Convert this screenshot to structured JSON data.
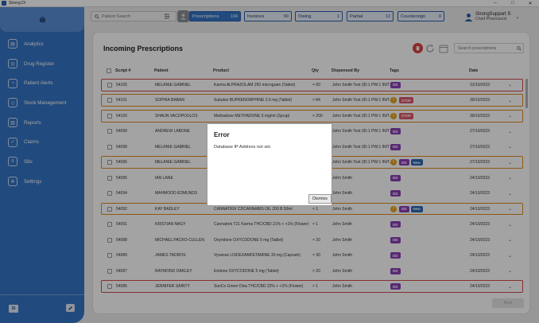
{
  "window": {
    "title": "Strong DI",
    "controls": [
      "–",
      "□",
      "✕"
    ]
  },
  "sidebar": {
    "items": [
      {
        "label": "Analytics",
        "icon": "analytics-icon",
        "glyph": "▤"
      },
      {
        "label": "Drug Register",
        "icon": "drug-register-icon",
        "glyph": "◎"
      },
      {
        "label": "Patient Alerts",
        "icon": "bell-icon",
        "glyph": "◔"
      },
      {
        "label": "Stock Management",
        "icon": "box-icon",
        "glyph": "◇"
      },
      {
        "label": "Reports",
        "icon": "bar-chart-icon",
        "glyph": "▥"
      },
      {
        "label": "Claims",
        "icon": "check-circle-icon",
        "glyph": "✓"
      },
      {
        "label": "S8s",
        "icon": "document-icon",
        "glyph": "≡"
      },
      {
        "label": "Settings",
        "icon": "gear-icon",
        "glyph": "✲"
      }
    ],
    "user_initials": "SI"
  },
  "topbar": {
    "search_placeholder": "Patient Search",
    "tabs": [
      {
        "label": "Prescriptions",
        "count": "104",
        "active": true
      },
      {
        "label": "Invoices",
        "count": "60",
        "active": false
      },
      {
        "label": "Owing",
        "count": "1",
        "active": false
      },
      {
        "label": "Partial",
        "count": "12",
        "active": false
      },
      {
        "label": "Countersign",
        "count": "0",
        "active": false
      }
    ],
    "user": {
      "name": "StrongSupport S",
      "role": "Chief Pharmacist"
    }
  },
  "main": {
    "title": "Incoming Prescriptions",
    "search_placeholder": "Search prescriptions",
    "columns": [
      "Script #",
      "Patient",
      "Product",
      "Qty",
      "Dispensed By",
      "Tags",
      "Date"
    ],
    "rows": [
      {
        "script": "54105",
        "patient": "MELANIE GABRIEL",
        "product": "Karma ALPRAZOLAM 250 microgram (Tablet)",
        "qty": "× 60",
        "dispensed_by": "John Smith Test (ID:1 PW:1 INIT...",
        "tags": [
          "DD"
        ],
        "warning": false,
        "date": "31/10/2023",
        "highlight": "red"
      },
      {
        "script": "54101",
        "patient": "SOPHIA BABAN",
        "product": "Subutex BUPRENORPHINE 2.0 mg (Tablet)",
        "qty": "× 84",
        "dispensed_by": "John Smith Test (ID:1 PW:1 INIT...",
        "tags": [
          "STOP"
        ],
        "warning": true,
        "date": "30/10/2023",
        "highlight": "orange"
      },
      {
        "script": "54100",
        "patient": "SHAUN VACOPOULOS",
        "product": "Methadone METHADONE 5 mg/ml (Syrup)",
        "qty": "× 200",
        "dispensed_by": "John Smith Test (ID:1 PW:1 INIT...",
        "tags": [
          "STOP"
        ],
        "warning": true,
        "date": "30/10/2023",
        "highlight": "orange"
      },
      {
        "script": "54099",
        "patient": "ANDREW LABONE",
        "product": "",
        "qty": "",
        "dispensed_by": "John Smith Test (ID:1 PW:1 INIT...",
        "tags": [
          "DD"
        ],
        "warning": false,
        "date": "27/10/2023",
        "highlight": ""
      },
      {
        "script": "54098",
        "patient": "MELANIE GABRIEL",
        "product": "",
        "qty": "",
        "dispensed_by": "John Smith Test (ID:1 PW:1 INIT...",
        "tags": [
          "DD"
        ],
        "warning": false,
        "date": "27/10/2023",
        "highlight": ""
      },
      {
        "script": "54096",
        "patient": "MELANIE GABRIEL",
        "product": "",
        "qty": "",
        "dispensed_by": "John Smith Test (ID:1 PW:1 INIT...",
        "tags": [
          "DD",
          "New"
        ],
        "warning": true,
        "date": "27/10/2023",
        "highlight": "orange"
      },
      {
        "script": "54095",
        "patient": "IAN LANE",
        "product": "",
        "qty": "",
        "dispensed_by": "John Smith",
        "tags": [
          "DD"
        ],
        "warning": false,
        "date": "24/10/2023",
        "highlight": ""
      },
      {
        "script": "54094",
        "patient": "MAHMOOD EDMUNDS",
        "product": "",
        "qty": "",
        "dispensed_by": "John Smith",
        "tags": [
          "DD"
        ],
        "warning": false,
        "date": "24/10/2023",
        "highlight": ""
      },
      {
        "script": "54092",
        "patient": "KAY BADLEY",
        "product": "CANNATRIX CDCANNABIS OIL 200 B 50ml",
        "qty": "× 1",
        "dispensed_by": "John Smith",
        "tags": [
          "DD",
          "New"
        ],
        "warning": true,
        "date": "24/10/2023",
        "highlight": "orange"
      },
      {
        "script": "54091",
        "patient": "KRISTIAN NAGY",
        "product": "Cannatrek T21 Karma THC/CBD 21% + <1% (Flower)",
        "qty": "× 1",
        "dispensed_by": "John Smith",
        "tags": [
          "DD"
        ],
        "warning": false,
        "date": "24/10/2023",
        "highlight": ""
      },
      {
        "script": "54088",
        "patient": "MICHAEL PACKO-CULLEN",
        "product": "Oxyndone OXYCODONE 5 mg (Tablet)",
        "qty": "× 20",
        "dispensed_by": "John Smith",
        "tags": [
          "DD"
        ],
        "warning": false,
        "date": "24/10/2023",
        "highlight": ""
      },
      {
        "script": "54089",
        "patient": "JAMES TADROS",
        "product": "Vyvanse LISDEXAMFETAMINE 30 mg (Capsule)",
        "qty": "× 30",
        "dispensed_by": "John Smith",
        "tags": [
          "DD"
        ],
        "warning": false,
        "date": "24/10/2023",
        "highlight": ""
      },
      {
        "script": "54087",
        "patient": "RAYMOND OAKLEY",
        "product": "Endone OXYCODONE 5 mg (Tablet)",
        "qty": "× 20",
        "dispensed_by": "John Smith",
        "tags": [
          "DD"
        ],
        "warning": false,
        "date": "24/10/2023",
        "highlight": ""
      },
      {
        "script": "54086",
        "patient": "JENNIFER SAINTY",
        "product": "SunCo Green Diva THC/CBD 22% + <1% (Flower)",
        "qty": "× 1",
        "dispensed_by": "John Smith",
        "tags": [
          "DD"
        ],
        "warning": false,
        "date": "24/10/2023",
        "highlight": "red"
      }
    ],
    "next_label": "Next"
  },
  "dialog": {
    "title": "Error",
    "message": "Database IP Address not set.",
    "button": "Dismiss"
  },
  "colors": {
    "sidebar": "#3474c6",
    "accent": "#2a5fb0",
    "tag_dd": "#8b3fb8",
    "tag_stop": "#e0566b",
    "tag_new": "#2d68b8",
    "warning": "#e7a11f",
    "highlight_red": "#d24a4a",
    "highlight_orange": "#e08a1e"
  }
}
